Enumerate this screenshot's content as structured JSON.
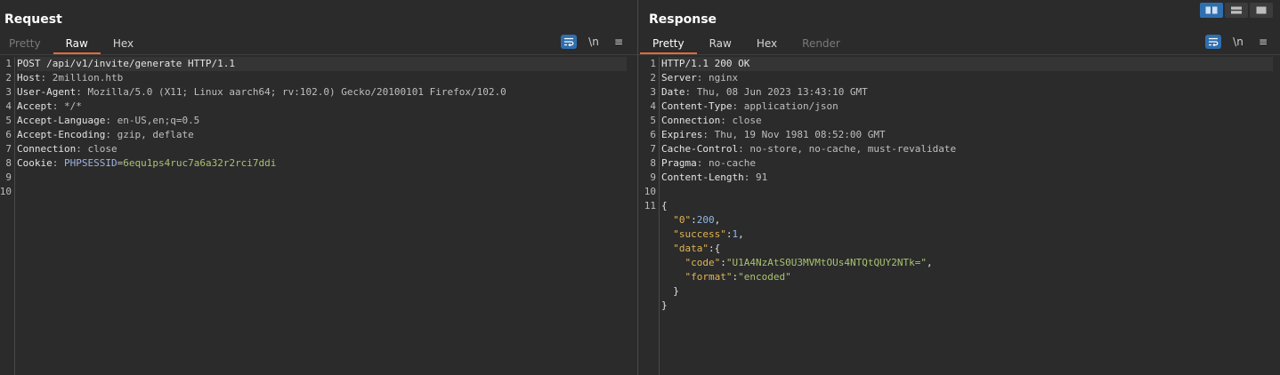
{
  "request": {
    "title": "Request",
    "tabs": [
      {
        "label": "Pretty",
        "state": "disabled"
      },
      {
        "label": "Raw",
        "state": "active"
      },
      {
        "label": "Hex",
        "state": "normal"
      }
    ],
    "tools": {
      "newline_label": "\\n",
      "menu_glyph": "≡"
    },
    "line_numbers": [
      "1",
      "2",
      "3",
      "4",
      "5",
      "6",
      "7",
      "8",
      "9",
      "10"
    ],
    "lines": {
      "l1": "POST /api/v1/invite/generate HTTP/1.1",
      "l2k": "Host",
      "l2v": "2million.htb",
      "l3k": "User-Agent",
      "l3v": "Mozilla/5.0 (X11; Linux aarch64; rv:102.0) Gecko/20100101 Firefox/102.0",
      "l4k": "Accept",
      "l4v": "*/*",
      "l5k": "Accept-Language",
      "l5v": "en-US,en;q=0.5",
      "l6k": "Accept-Encoding",
      "l6v": "gzip, deflate",
      "l7k": "Connection",
      "l7v": "close",
      "l8k": "Cookie",
      "l8ck": "PHPSESSID",
      "l8cv": "6equ1ps4ruc7a6a32r2rci7ddi"
    }
  },
  "response": {
    "title": "Response",
    "tabs": [
      {
        "label": "Pretty",
        "state": "active"
      },
      {
        "label": "Raw",
        "state": "normal"
      },
      {
        "label": "Hex",
        "state": "normal"
      },
      {
        "label": "Render",
        "state": "disabled"
      }
    ],
    "tools": {
      "newline_label": "\\n",
      "menu_glyph": "≡"
    },
    "line_numbers": [
      "1",
      "2",
      "3",
      "4",
      "5",
      "6",
      "7",
      "8",
      "9",
      "10",
      "11"
    ],
    "lines": {
      "l1": "HTTP/1.1 200 OK",
      "l2k": "Server",
      "l2v": "nginx",
      "l3k": "Date",
      "l3v": "Thu, 08 Jun 2023 13:43:10 GMT",
      "l4k": "Content-Type",
      "l4v": "application/json",
      "l5k": "Connection",
      "l5v": "close",
      "l6k": "Expires",
      "l6v": "Thu, 19 Nov 1981 08:52:00 GMT",
      "l7k": "Cache-Control",
      "l7v": "no-store, no-cache, must-revalidate",
      "l8k": "Pragma",
      "l8v": "no-cache",
      "l9k": "Content-Length",
      "l9v": "91"
    },
    "json": {
      "key0": "\"0\"",
      "val0": "200",
      "key_success": "\"success\"",
      "val_success": "1",
      "key_data": "\"data\"",
      "key_code": "\"code\"",
      "val_code": "\"U1A4NzAtS0U3MVMtOUs4NTQtQUY2NTk=\"",
      "key_format": "\"format\"",
      "val_format": "\"encoded\""
    }
  },
  "layout_buttons": [
    {
      "icon": "split-horizontal-icon",
      "active": true
    },
    {
      "icon": "split-vertical-icon",
      "active": false
    },
    {
      "icon": "single-pane-icon",
      "active": false
    }
  ],
  "colors": {
    "accent": "#e8693a",
    "button_blue": "#2f6fb0",
    "background": "#2b2b2b"
  }
}
